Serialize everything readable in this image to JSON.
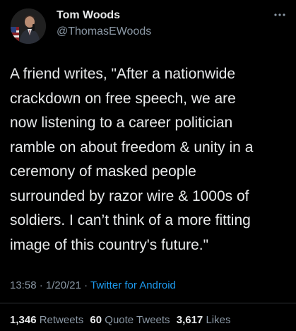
{
  "author": {
    "display_name": "Tom Woods",
    "handle": "@ThomasEWoods"
  },
  "tweet": {
    "lines": [
      "A friend writes, \"After a nationwide",
      "crackdown on free speech, we are",
      "now listening to a career politician",
      "ramble on about freedom & unity in a",
      "ceremony of masked people",
      "surrounded by razor wire & 1000s of",
      "soldiers. I can’t think of a more fitting",
      "image of this country's future.\""
    ],
    "time": "13:58",
    "separator": "·",
    "date": "1/20/21",
    "source": "Twitter for Android"
  },
  "stats": {
    "retweets_count": "1,346",
    "retweets_label": "Retweets",
    "quotes_count": "60",
    "quotes_label": "Quote Tweets",
    "likes_count": "3,617",
    "likes_label": "Likes"
  },
  "icons": {
    "more": "more-horizontal-icon"
  },
  "colors": {
    "background": "#000000",
    "text": "#e7e9ea",
    "secondary": "#8b98a5",
    "link": "#1d9bf0"
  }
}
